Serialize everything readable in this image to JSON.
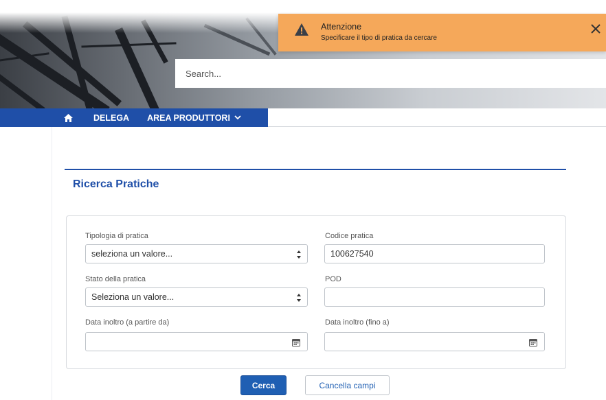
{
  "toast": {
    "title": "Attenzione",
    "message": "Specificare il tipo di pratica da cercare",
    "icon": "warning-icon",
    "close_icon": "close-icon",
    "color": "#f5a85a"
  },
  "header": {
    "search_placeholder": "Search..."
  },
  "nav": {
    "home_icon": "home-icon",
    "items": [
      {
        "label": "DELEGA"
      },
      {
        "label": "AREA PRODUTTORI",
        "icon": "chevron-down-icon"
      }
    ],
    "color": "#1f4fa8"
  },
  "main": {
    "title": "Ricerca Pratiche"
  },
  "form": {
    "tipologia": {
      "label": "Tipologia di pratica",
      "value": "seleziona un valore..."
    },
    "codice": {
      "label": "Codice pratica",
      "value": "100627540"
    },
    "stato": {
      "label": "Stato della pratica",
      "value": "Seleziona un valore..."
    },
    "pod": {
      "label": "POD",
      "value": ""
    },
    "data_da": {
      "label": "Data inoltro (a partire da)",
      "value": "",
      "icon": "calendar-icon"
    },
    "data_a": {
      "label": "Data inoltro (fino a)",
      "value": "",
      "icon": "calendar-icon"
    }
  },
  "actions": {
    "search_label": "Cerca",
    "clear_label": "Cancella campi"
  }
}
